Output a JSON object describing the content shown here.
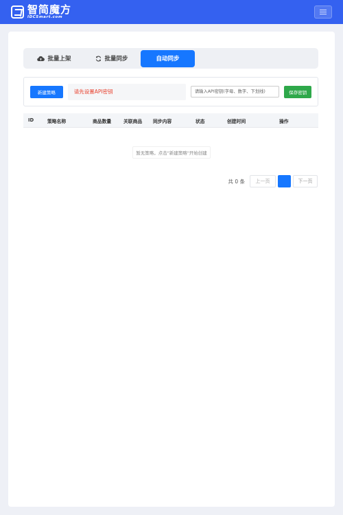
{
  "brand": {
    "name_cn": "智简魔方",
    "name_en": "IDCSmart.com"
  },
  "tabs": [
    {
      "label": "批量上架",
      "icon": "cloud-upload-icon",
      "active": false
    },
    {
      "label": "批量同步",
      "icon": "sync-icon",
      "active": false
    },
    {
      "label": "自动同步",
      "icon": "",
      "active": true
    }
  ],
  "toolbar": {
    "new_label": "新建策略",
    "alert_text": "请先设置API密钥",
    "api_placeholder": "请输入API密钥(字母、数字、下划线)",
    "save_label": "保存密钥"
  },
  "table": {
    "columns": [
      "ID",
      "策略名称",
      "商品数量",
      "关联商品",
      "同步内容",
      "状态",
      "创建时间",
      "操作"
    ],
    "empty_text": "暂无策略，点击\"新建策略\"开始创建"
  },
  "pagination": {
    "total_text": "共 0 条",
    "prev_label": "上一页",
    "next_label": "下一页",
    "current_page": ""
  },
  "colors": {
    "topbar": "#3461f0",
    "primary": "#1677ff",
    "success": "#2ea84a",
    "danger": "#e8412e"
  }
}
